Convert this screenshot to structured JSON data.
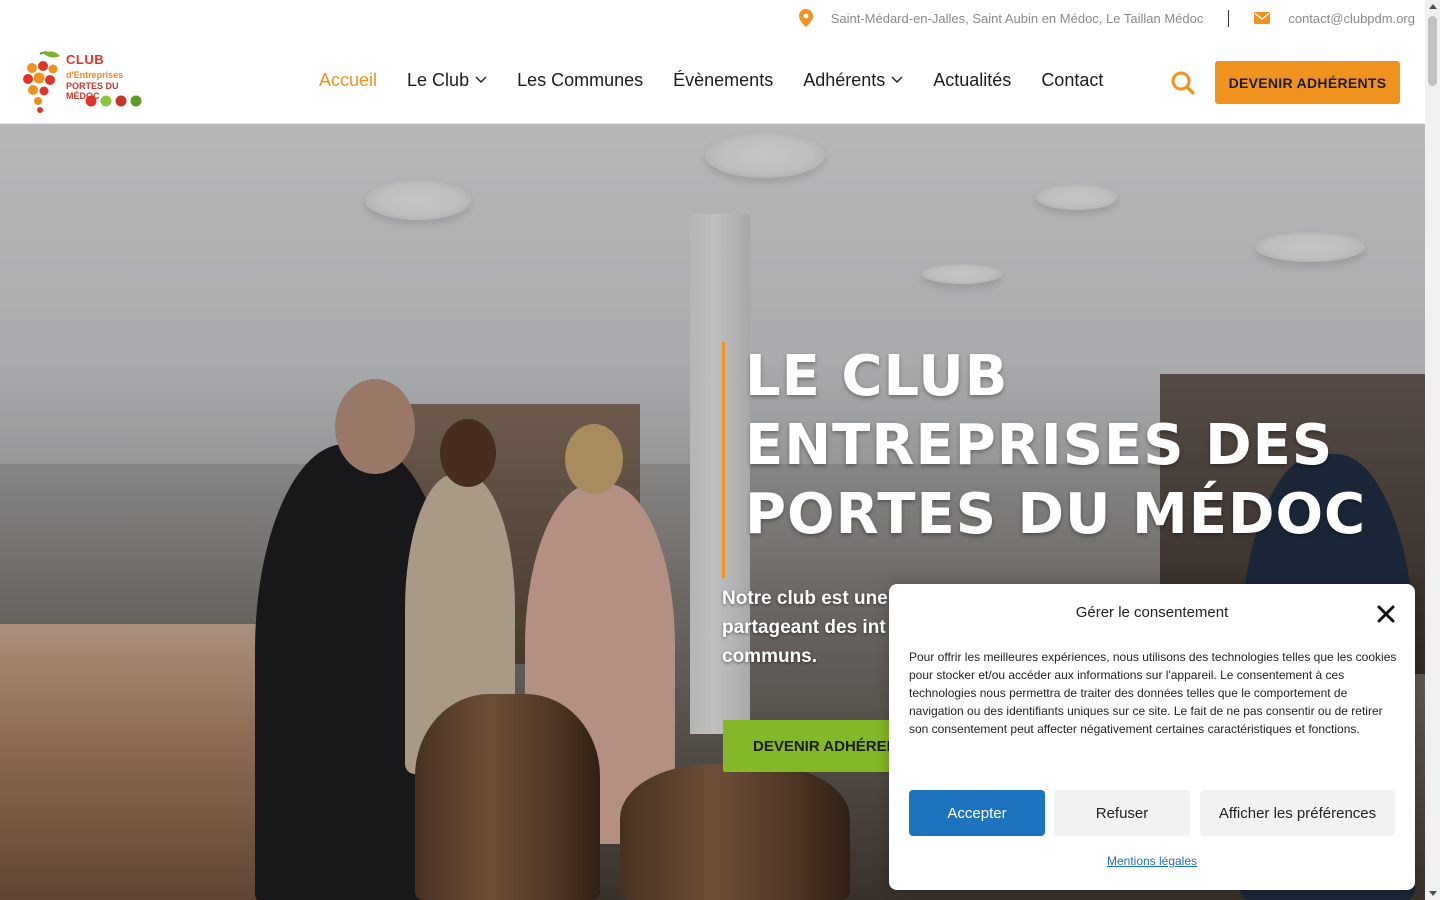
{
  "topbar": {
    "location": "Saint-Médard-en-Jalles, Saint Aubin en Médoc, Le Taillan Médoc",
    "email": "contact@clubpdm.org"
  },
  "logo": {
    "line1": "CLUB",
    "line2": "d'Entreprises",
    "line3": "PORTES DU MÉDOC"
  },
  "nav": {
    "items": [
      {
        "label": "Accueil",
        "active": true,
        "dropdown": false
      },
      {
        "label": "Le Club",
        "active": false,
        "dropdown": true
      },
      {
        "label": "Les Communes",
        "active": false,
        "dropdown": false
      },
      {
        "label": "Évènements",
        "active": false,
        "dropdown": false
      },
      {
        "label": "Adhérents",
        "active": false,
        "dropdown": true
      },
      {
        "label": "Actualités",
        "active": false,
        "dropdown": false
      },
      {
        "label": "Contact",
        "active": false,
        "dropdown": false
      }
    ],
    "cta_label": "DEVENIR ADHÉRENTS"
  },
  "hero": {
    "title_lines": [
      "LE CLUB",
      "ENTREPRISES DES",
      "PORTES DU MÉDOC"
    ],
    "text": "Notre club est une partageant des int communs.",
    "text_lines": [
      "Notre club est une",
      "partageant des int",
      "communs."
    ],
    "cta_label": "DEVENIR ADHÉRENTS"
  },
  "consent": {
    "title": "Gérer le consentement",
    "body": "Pour offrir les meilleures expériences, nous utilisons des technologies telles que les cookies pour stocker et/ou accéder aux informations sur l'appareil. Le consentement à ces technologies nous permettra de traiter des données telles que le comportement de navigation ou des identifiants uniques sur ce site. Le fait de ne pas consentir ou de retirer son consentement peut affecter négativement certaines caractéristiques et fonctions.",
    "accept_label": "Accepter",
    "refuse_label": "Refuser",
    "prefs_label": "Afficher les préférences",
    "legal_link": "Mentions légales"
  },
  "colors": {
    "accent_orange": "#f0921e",
    "accent_green": "#84b828",
    "consent_blue": "#1e73be"
  },
  "icons": {
    "location": "map-pin-icon",
    "email": "envelope-icon",
    "search": "search-icon",
    "close": "close-icon",
    "dropdown": "chevron-down-icon"
  }
}
